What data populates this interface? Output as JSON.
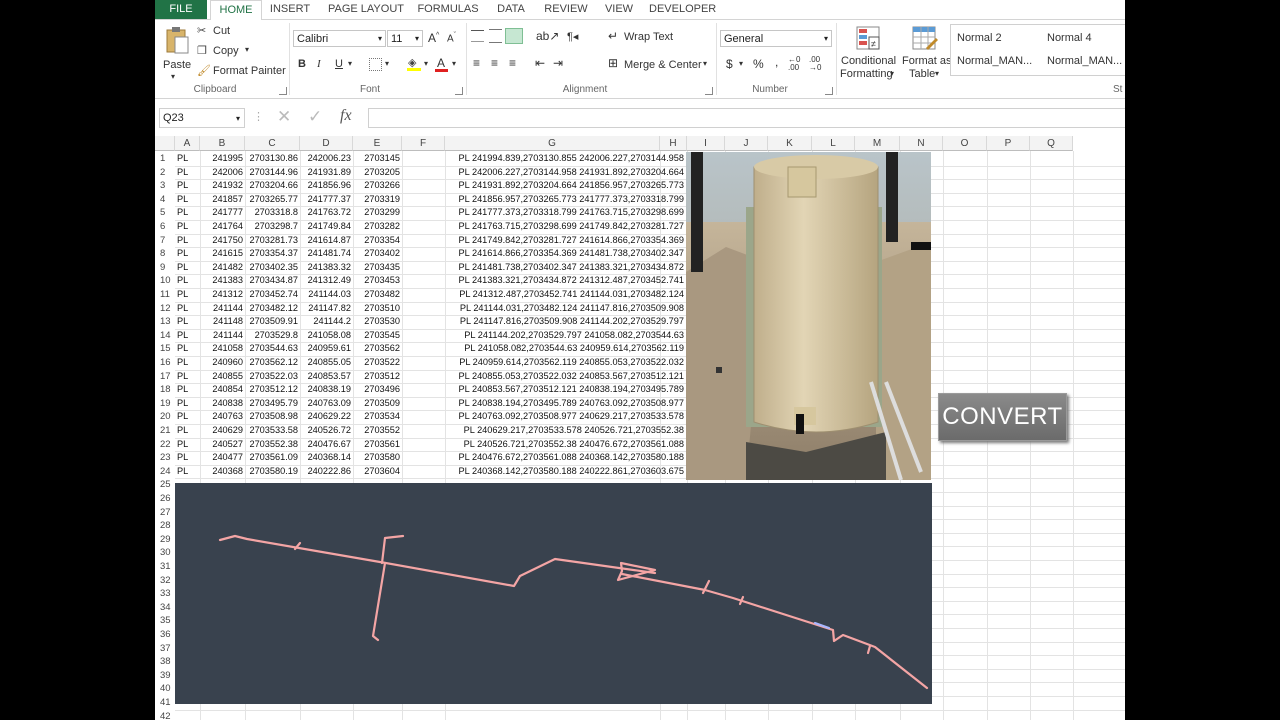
{
  "ribbon": {
    "tabs": [
      "FILE",
      "HOME",
      "INSERT",
      "PAGE LAYOUT",
      "FORMULAS",
      "DATA",
      "REVIEW",
      "VIEW",
      "DEVELOPER"
    ],
    "clipboard": {
      "paste": "Paste",
      "cut": "Cut",
      "copy": "Copy",
      "format_painter": "Format Painter",
      "label": "Clipboard"
    },
    "font": {
      "name": "Calibri",
      "size": "11",
      "label": "Font",
      "bold": "B",
      "italic": "I",
      "underline": "U"
    },
    "alignment": {
      "wrap": "Wrap Text",
      "merge": "Merge & Center",
      "label": "Alignment"
    },
    "number": {
      "format": "General",
      "currency": "$",
      "percent": "%",
      "comma": ",",
      "label": "Number"
    },
    "styles": {
      "conditional1": "Conditional",
      "conditional2": "Formatting",
      "format_table1": "Format as",
      "format_table2": "Table",
      "cells": [
        "Normal 2",
        "Normal 4",
        "Normal_MAN...",
        "Normal_MAN..."
      ],
      "label_partial": "St"
    }
  },
  "formula_bar": {
    "name_box": "Q23",
    "fx": "fx",
    "value": ""
  },
  "columns": [
    "A",
    "B",
    "C",
    "D",
    "E",
    "F",
    "G",
    "H",
    "I",
    "J",
    "K",
    "L",
    "M",
    "N",
    "O",
    "P",
    "Q"
  ],
  "rows": [
    {
      "n": "1",
      "a": "PL",
      "b": "241995",
      "c": "2703130.86",
      "d": "242006.23",
      "e": "2703145",
      "g": "PL 241994.839,2703130.855 242006.227,2703144.958"
    },
    {
      "n": "2",
      "a": "PL",
      "b": "242006",
      "c": "2703144.96",
      "d": "241931.89",
      "e": "2703205",
      "g": "PL 242006.227,2703144.958 241931.892,2703204.664"
    },
    {
      "n": "3",
      "a": "PL",
      "b": "241932",
      "c": "2703204.66",
      "d": "241856.96",
      "e": "2703266",
      "g": "PL 241931.892,2703204.664 241856.957,2703265.773"
    },
    {
      "n": "4",
      "a": "PL",
      "b": "241857",
      "c": "2703265.77",
      "d": "241777.37",
      "e": "2703319",
      "g": "PL 241856.957,2703265.773 241777.373,2703318.799"
    },
    {
      "n": "5",
      "a": "PL",
      "b": "241777",
      "c": "2703318.8",
      "d": "241763.72",
      "e": "2703299",
      "g": "PL 241777.373,2703318.799 241763.715,2703298.699"
    },
    {
      "n": "6",
      "a": "PL",
      "b": "241764",
      "c": "2703298.7",
      "d": "241749.84",
      "e": "2703282",
      "g": "PL 241763.715,2703298.699 241749.842,2703281.727"
    },
    {
      "n": "7",
      "a": "PL",
      "b": "241750",
      "c": "2703281.73",
      "d": "241614.87",
      "e": "2703354",
      "g": "PL 241749.842,2703281.727 241614.866,2703354.369"
    },
    {
      "n": "8",
      "a": "PL",
      "b": "241615",
      "c": "2703354.37",
      "d": "241481.74",
      "e": "2703402",
      "g": "PL 241614.866,2703354.369 241481.738,2703402.347"
    },
    {
      "n": "9",
      "a": "PL",
      "b": "241482",
      "c": "2703402.35",
      "d": "241383.32",
      "e": "2703435",
      "g": "PL 241481.738,2703402.347 241383.321,2703434.872"
    },
    {
      "n": "10",
      "a": "PL",
      "b": "241383",
      "c": "2703434.87",
      "d": "241312.49",
      "e": "2703453",
      "g": "PL 241383.321,2703434.872 241312.487,2703452.741"
    },
    {
      "n": "11",
      "a": "PL",
      "b": "241312",
      "c": "2703452.74",
      "d": "241144.03",
      "e": "2703482",
      "g": "PL 241312.487,2703452.741 241144.031,2703482.124"
    },
    {
      "n": "12",
      "a": "PL",
      "b": "241144",
      "c": "2703482.12",
      "d": "241147.82",
      "e": "2703510",
      "g": "PL 241144.031,2703482.124 241147.816,2703509.908"
    },
    {
      "n": "13",
      "a": "PL",
      "b": "241148",
      "c": "2703509.91",
      "d": "241144.2",
      "e": "2703530",
      "g": "PL 241147.816,2703509.908 241144.202,2703529.797"
    },
    {
      "n": "14",
      "a": "PL",
      "b": "241144",
      "c": "2703529.8",
      "d": "241058.08",
      "e": "2703545",
      "g": "PL 241144.202,2703529.797 241058.082,2703544.63"
    },
    {
      "n": "15",
      "a": "PL",
      "b": "241058",
      "c": "2703544.63",
      "d": "240959.61",
      "e": "2703562",
      "g": "PL 241058.082,2703544.63 240959.614,2703562.119"
    },
    {
      "n": "16",
      "a": "PL",
      "b": "240960",
      "c": "2703562.12",
      "d": "240855.05",
      "e": "2703522",
      "g": "PL 240959.614,2703562.119 240855.053,2703522.032"
    },
    {
      "n": "17",
      "a": "PL",
      "b": "240855",
      "c": "2703522.03",
      "d": "240853.57",
      "e": "2703512",
      "g": "PL 240855.053,2703522.032 240853.567,2703512.121"
    },
    {
      "n": "18",
      "a": "PL",
      "b": "240854",
      "c": "2703512.12",
      "d": "240838.19",
      "e": "2703496",
      "g": "PL 240853.567,2703512.121 240838.194,2703495.789"
    },
    {
      "n": "19",
      "a": "PL",
      "b": "240838",
      "c": "2703495.79",
      "d": "240763.09",
      "e": "2703509",
      "g": "PL 240838.194,2703495.789 240763.092,2703508.977"
    },
    {
      "n": "20",
      "a": "PL",
      "b": "240763",
      "c": "2703508.98",
      "d": "240629.22",
      "e": "2703534",
      "g": "PL 240763.092,2703508.977 240629.217,2703533.578"
    },
    {
      "n": "21",
      "a": "PL",
      "b": "240629",
      "c": "2703533.58",
      "d": "240526.72",
      "e": "2703552",
      "g": "PL 240629.217,2703533.578 240526.721,2703552.38"
    },
    {
      "n": "22",
      "a": "PL",
      "b": "240527",
      "c": "2703552.38",
      "d": "240476.67",
      "e": "2703561",
      "g": "PL 240526.721,2703552.38 240476.672,2703561.088"
    },
    {
      "n": "23",
      "a": "PL",
      "b": "240477",
      "c": "2703561.09",
      "d": "240368.14",
      "e": "2703580",
      "g": "PL 240476.672,2703561.088 240368.142,2703580.188"
    },
    {
      "n": "24",
      "a": "PL",
      "b": "240368",
      "c": "2703580.19",
      "d": "240222.86",
      "e": "2703604",
      "g": "PL 240368.142,2703580.188 240222.861,2703603.675"
    }
  ],
  "hidden_rows": [
    "25",
    "26",
    "27",
    "28",
    "29",
    "30",
    "31",
    "32",
    "33",
    "34",
    "35",
    "36",
    "37",
    "38",
    "39",
    "40",
    "41",
    "42"
  ],
  "convert_button": "CONVERT",
  "colors": {
    "excel_green": "#217346",
    "cad_bg": "#39424e",
    "cad_line": "#f4a5a5"
  }
}
